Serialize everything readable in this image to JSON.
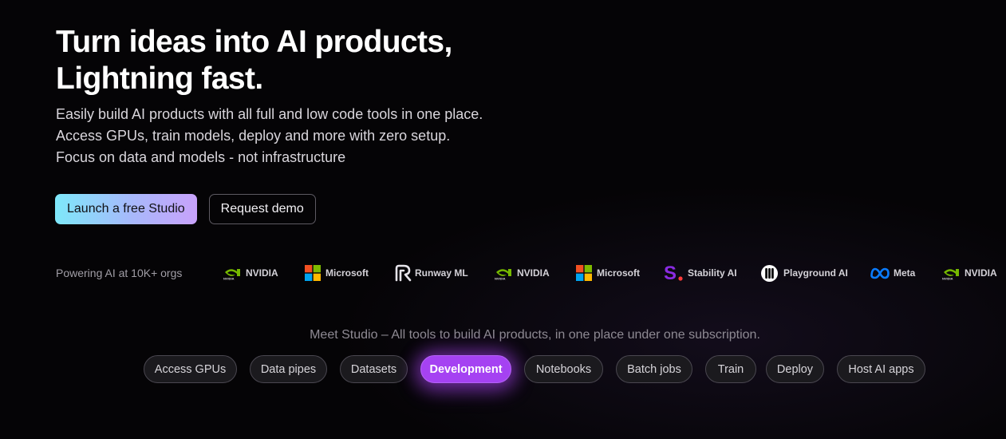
{
  "hero": {
    "headline_line1": "Turn ideas into AI products,",
    "headline_line2": "Lightning fast.",
    "sub_line1": "Easily build AI products with all full and low code tools in one place.",
    "sub_line2": "Access GPUs, train models, deploy and more with zero setup.",
    "sub_line3": "Focus on data and models - not infrastructure"
  },
  "cta": {
    "primary_label": "Launch a free Studio",
    "secondary_label": "Request demo"
  },
  "logos": {
    "intro": "Powering AI at 10K+ orgs",
    "items": [
      {
        "name": "NVIDIA",
        "icon": "nvidia-logo"
      },
      {
        "name": "Microsoft",
        "icon": "microsoft-logo"
      },
      {
        "name": "Runway ML",
        "icon": "runway-logo"
      },
      {
        "name": "NVIDIA",
        "icon": "nvidia-logo"
      },
      {
        "name": "Microsoft",
        "icon": "microsoft-logo"
      },
      {
        "name": "Stability AI",
        "icon": "stability-logo"
      },
      {
        "name": "Playground AI",
        "icon": "playground-logo"
      },
      {
        "name": "Meta",
        "icon": "meta-logo"
      },
      {
        "name": "NVIDIA",
        "icon": "nvidia-logo"
      }
    ]
  },
  "studio": {
    "tagline": "Meet Studio – All tools to build AI products, in one place under one subscription.",
    "tabs": [
      "Access GPUs",
      "Data pipes",
      "Datasets",
      "Development",
      "Notebooks",
      "Batch jobs",
      "Train",
      "Deploy",
      "Host AI apps"
    ],
    "active_tab": "Development"
  },
  "colors": {
    "background": "#050406",
    "active_tab": "#a542f2",
    "cta_gradient_start": "#7ee8fa",
    "cta_gradient_end": "#c8a2fb",
    "nvidia_green": "#76b900",
    "stability_purple": "#8a2be2",
    "meta_blue": "#0a7cff"
  }
}
